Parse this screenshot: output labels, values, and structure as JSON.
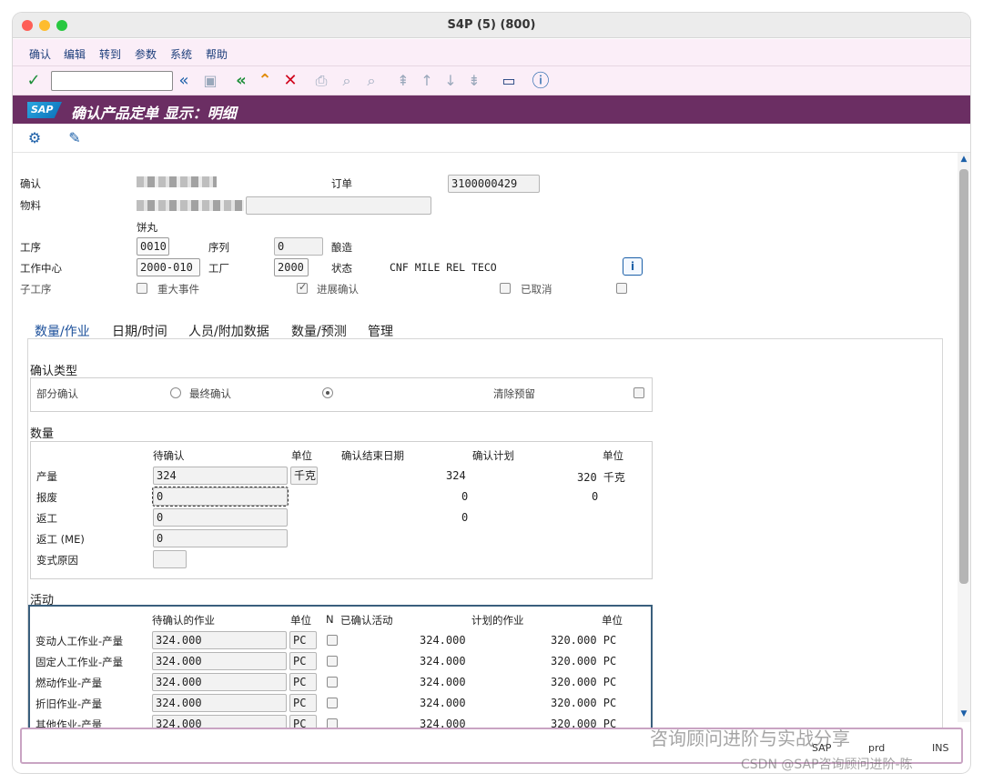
{
  "window": {
    "title": "S4P (5) (800)"
  },
  "menubar": {
    "items": [
      "确认",
      "编辑",
      "转到",
      "参数",
      "系统",
      "帮助"
    ]
  },
  "header": {
    "logo": "SAP",
    "title": "确认产品定单 显示：明细"
  },
  "form": {
    "confirm_label": "确认",
    "order_label": "订单",
    "order_value": "3100000429",
    "material_label": "物料",
    "material_desc": "饼丸",
    "operation_label": "工序",
    "operation_value": "0010",
    "sequence_label": "序列",
    "sequence_value": "0",
    "brewing_label": "酿造",
    "workcenter_label": "工作中心",
    "workcenter_value": "2000-010",
    "plant_label": "工厂",
    "plant_value": "2000",
    "status_label": "状态",
    "status_value": "CNF  MILE REL  TECO",
    "info_icon": "i",
    "suboperation_label": "子工序",
    "major_event_label": "重大事件",
    "progress_confirm_label": "进展确认",
    "cancelled_label": "已取消"
  },
  "tabs": [
    "数量/作业",
    "日期/时间",
    "人员/附加数据",
    "数量/预测",
    "管理"
  ],
  "confirm_type": {
    "title": "确认类型",
    "partial": "部分确认",
    "final": "最终确认",
    "clear_reservation": "清除预留"
  },
  "quantity": {
    "title": "数量",
    "headers": {
      "to_confirm": "待确认",
      "unit": "单位",
      "end_date": "确认结束日期",
      "planned": "确认计划",
      "unit2": "单位"
    },
    "rows": [
      {
        "label": "产量",
        "value": "324",
        "unit": "千克",
        "date_val": "324",
        "planned": "320 千克"
      },
      {
        "label": "报废",
        "value": "0",
        "date_val": "0",
        "planned": "0"
      },
      {
        "label": "返工",
        "value": "0",
        "date_val": "0"
      },
      {
        "label": "返工 (ME)",
        "value": "0"
      },
      {
        "label": "变式原因",
        "value": ""
      }
    ]
  },
  "activities": {
    "title": "活动",
    "headers": {
      "to_confirm": "待确认的作业",
      "unit": "单位",
      "n": "N",
      "confirmed": "已确认活动",
      "planned": "计划的作业",
      "unit2": "单位"
    },
    "rows": [
      {
        "label": "变动人工作业-产量",
        "value": "324.000",
        "unit": "PC",
        "confirmed": "324.000",
        "planned": "320.000 PC"
      },
      {
        "label": "固定人工作业-产量",
        "value": "324.000",
        "unit": "PC",
        "confirmed": "324.000",
        "planned": "320.000 PC"
      },
      {
        "label": "燃动作业-产量",
        "value": "324.000",
        "unit": "PC",
        "confirmed": "324.000",
        "planned": "320.000 PC"
      },
      {
        "label": "折旧作业-产量",
        "value": "324.000",
        "unit": "PC",
        "confirmed": "324.000",
        "planned": "320.000 PC"
      },
      {
        "label": "其他作业-产量",
        "value": "324.000",
        "unit": "PC",
        "confirmed": "324.000",
        "planned": "320.000 PC"
      }
    ]
  },
  "statusbar": {
    "system": "SAP",
    "info1": "prd",
    "mode": "INS"
  },
  "watermark": {
    "line1": "咨询顾问进阶与实战分享",
    "line2": "CSDN @SAP咨询顾问进阶-陈"
  }
}
